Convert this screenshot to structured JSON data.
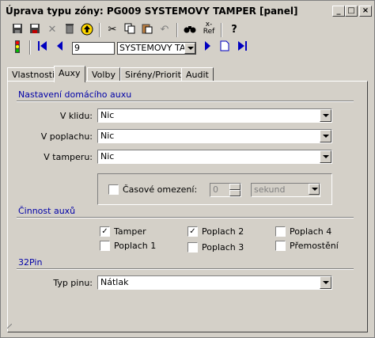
{
  "window": {
    "title": "Úprava typu zóny: PG009 SYSTEMOVY TAMPER [panel]",
    "minimize": "_",
    "maximize": "□",
    "close": "×"
  },
  "toolbar": {
    "record_number": "9",
    "record_name": "SYSTEMOVY TA",
    "ref_label": "Ref",
    "help": "?"
  },
  "tabs": [
    "Vlastnosti",
    "Auxy",
    "Volby",
    "Sirény/Priority",
    "Audit"
  ],
  "active_tab": "Auxy",
  "section1": {
    "title": "Nastavení domácího auxu",
    "rows": [
      {
        "label": "V klidu:",
        "value": "Nic"
      },
      {
        "label": "V poplachu:",
        "value": "Nic"
      },
      {
        "label": "V tamperu:",
        "value": "Nic"
      }
    ],
    "time_limit": {
      "label": "Časové omezení:",
      "checked": false,
      "value": "0",
      "unit": "sekund"
    }
  },
  "section2": {
    "title": "Činnost auxů",
    "checkboxes": [
      {
        "label": "Tamper",
        "checked": true
      },
      {
        "label": "Poplach 1",
        "checked": false
      },
      {
        "label": "Poplach 2",
        "checked": true
      },
      {
        "label": "Poplach 3",
        "checked": false
      },
      {
        "label": "Poplach 4",
        "checked": false
      },
      {
        "label": "Přemostění",
        "checked": false
      }
    ]
  },
  "section3": {
    "title": "32Pin",
    "pin_type_label": "Typ pinu:",
    "pin_type_value": "Nátlak"
  }
}
